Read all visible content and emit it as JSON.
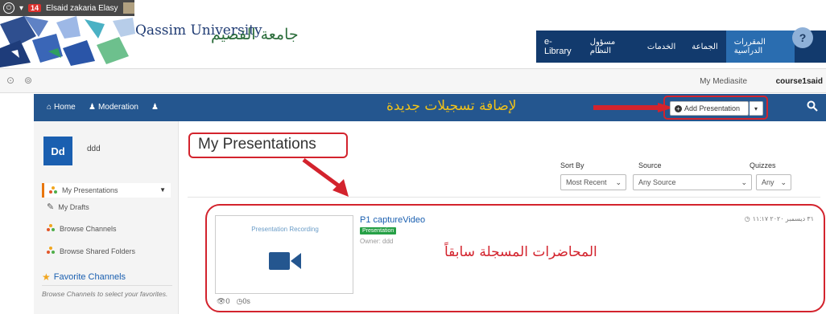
{
  "os_bar": {
    "badge_count": "14",
    "user_name": "Elsaid zakaria Elasy"
  },
  "portal": {
    "logo_en": "Qassim University",
    "logo_ar": "جامعة القصيم",
    "nav": [
      "المقررات الدراسية",
      "الجماعة",
      "الخدمات",
      "مسؤول النظام",
      "e-Library"
    ],
    "help": "?"
  },
  "site_bar": {
    "my_mediasite": "My Mediasite",
    "course": "course1said"
  },
  "app_nav": {
    "home": "Home",
    "moderation": "Moderation",
    "annotation_add": "لإضافة تسجيلات جديدة",
    "add_presentation": "Add Presentation"
  },
  "sidebar": {
    "avatar_initials": "Dd",
    "user_name": "ddd",
    "items": [
      {
        "label": "My Presentations",
        "icon": "colored-dots-icon"
      },
      {
        "label": "My Drafts",
        "icon": "edit-icon"
      },
      {
        "label": "Browse Channels",
        "icon": "colored-dots-icon"
      },
      {
        "label": "Browse Shared Folders",
        "icon": "colored-dots-icon"
      }
    ],
    "favorites_title": "Favorite Channels",
    "favorites_desc": "Browse Channels to select your favorites."
  },
  "main": {
    "page_title": "My Presentations",
    "sort_by_label": "Sort By",
    "sort_by_value": "Most Recent",
    "source_label": "Source",
    "source_value": "Any Source",
    "quizzes_label": "Quizzes",
    "quizzes_value": "Any"
  },
  "presentation": {
    "title": "P1 captureVideo",
    "badge": "Presentation",
    "owner": "Owner: ddd",
    "date": "٣١ ديسمبر ٢٠٢٠ ١١:١٧",
    "thumb_label": "Presentation Recording",
    "views": "0",
    "duration": "0s"
  },
  "annotations": {
    "list_note": "المحاضرات المسجلة سابقاً"
  },
  "colors": {
    "portal_nav": "#123a6d",
    "app_nav": "#24568f",
    "annotation_red": "#d3232d",
    "annotation_yellow": "#f2c318",
    "avatar_blue": "#1a5fb0",
    "badge_green": "#26a046"
  }
}
